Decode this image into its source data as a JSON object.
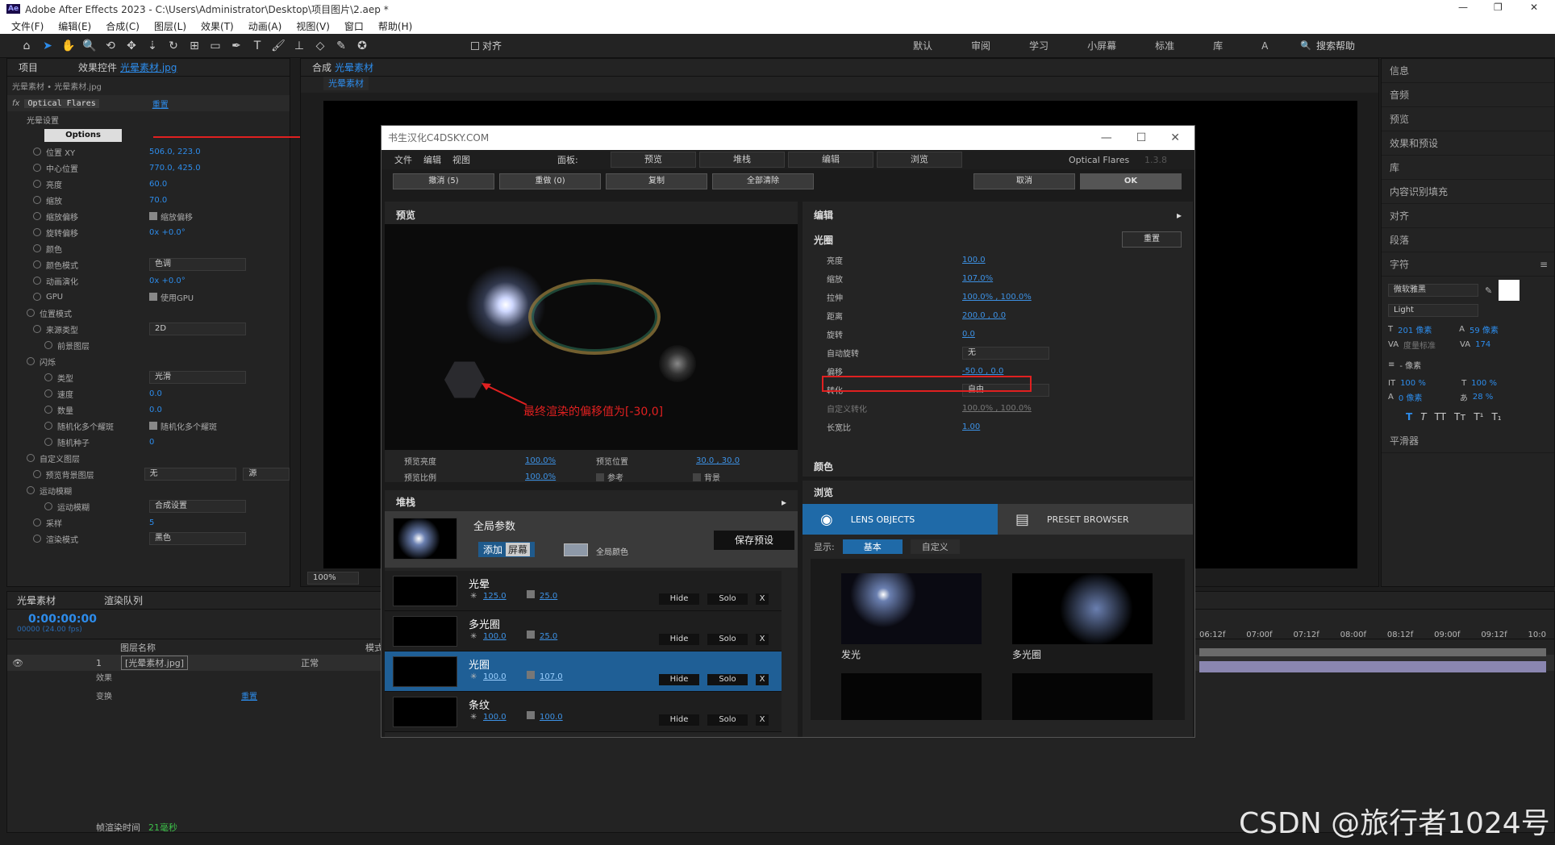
{
  "app": {
    "title": "Adobe After Effects 2023 - C:\\Users\\Administrator\\Desktop\\项目图片\\2.aep *",
    "logo": "Ae"
  },
  "menu": [
    "文件(F)",
    "编辑(E)",
    "合成(C)",
    "图层(L)",
    "效果(T)",
    "动画(A)",
    "视图(V)",
    "窗口",
    "帮助(H)"
  ],
  "toolbar": {
    "snap_label": "对齐",
    "workspaces": [
      "默认",
      "审阅",
      "学习",
      "小屏幕",
      "标准",
      "库",
      "A"
    ],
    "search_placeholder": "搜索帮助"
  },
  "left_panel": {
    "tab_project": "项目",
    "tab_effects": "效果控件",
    "tab_effects_file": "光晕素材.jpg",
    "breadcrumb": "光晕素材 • 光晕素材.jpg",
    "effect_name": "Optical Flares",
    "reset": "重置",
    "group_flare": "光晕设置",
    "options_btn": "Options",
    "props": [
      {
        "label": "位置 XY",
        "value": "506.0, 223.0"
      },
      {
        "label": "中心位置",
        "value": "770.0, 425.0"
      },
      {
        "label": "亮度",
        "value": "60.0"
      },
      {
        "label": "缩放",
        "value": "70.0"
      },
      {
        "label": "缩放偏移",
        "value": "缩放偏移"
      },
      {
        "label": "旋转偏移",
        "value": "0x +0.0°"
      },
      {
        "label": "颜色",
        "value": ""
      },
      {
        "label": "颜色模式",
        "value": "色调"
      },
      {
        "label": "动画演化",
        "value": "0x +0.0°"
      },
      {
        "label": "GPU",
        "value": "使用GPU"
      },
      {
        "label": "位置模式",
        "value": ""
      },
      {
        "label": "来源类型",
        "value": "2D"
      },
      {
        "label": "前景图层",
        "value": ""
      },
      {
        "label": "闪烁",
        "value": ""
      },
      {
        "label": "类型",
        "value": "光滑"
      },
      {
        "label": "速度",
        "value": "0.0"
      },
      {
        "label": "数量",
        "value": "0.0"
      },
      {
        "label": "随机化多个耀斑",
        "value": "随机化多个耀斑"
      },
      {
        "label": "随机种子",
        "value": "0"
      },
      {
        "label": "自定义图层",
        "value": ""
      },
      {
        "label": "预览背景图层",
        "value": "无"
      },
      {
        "label": "运动模糊",
        "value": ""
      },
      {
        "label": "运动模糊",
        "value": "合成设置"
      },
      {
        "label": "采样",
        "value": "5"
      },
      {
        "label": "渲染模式",
        "value": "黑色"
      }
    ],
    "source_label": "源"
  },
  "comp_panel": {
    "tab": "合成",
    "comp_name": "光晕素材",
    "sub_tab": "光晕素材",
    "zoom": "100%"
  },
  "dialog": {
    "title": "书生汉化C4DSKY.COM",
    "menu": [
      "文件",
      "编辑",
      "视图"
    ],
    "panel_label": "面板:",
    "tabs": [
      "预览",
      "堆栈",
      "编辑",
      "浏览"
    ],
    "brand": "Optical Flares",
    "version": "1.3.8",
    "btn_undo": "撤消 (5)",
    "btn_redo": "重做 (0)",
    "btn_copy": "复制",
    "btn_clear": "全部清除",
    "btn_cancel": "取消",
    "btn_ok": "OK",
    "preview_title": "预览",
    "annotation": "最终渲染的偏移值为[-30,0]",
    "preview_brightness_label": "预览亮度",
    "preview_brightness": "100.0%",
    "preview_scale_label": "预览比例",
    "preview_scale": "100.0%",
    "preview_pos_label": "预览位置",
    "preview_pos": "30.0 , 30.0",
    "ref_label": "参考",
    "bg_label": "背景",
    "edit_title": "编辑",
    "edit_sub": "光圈",
    "edit_reset": "重置",
    "edit_rows": [
      {
        "label": "亮度",
        "value": "100.0"
      },
      {
        "label": "缩放",
        "value": "107.0%"
      },
      {
        "label": "拉伸",
        "value": "100.0% , 100.0%"
      },
      {
        "label": "距离",
        "value": "200.0 , 0.0"
      },
      {
        "label": "旋转",
        "value": "0.0"
      },
      {
        "label": "自动旋转",
        "value": "无"
      },
      {
        "label": "偏移",
        "value": "-50.0 , 0.0"
      },
      {
        "label": "转化",
        "value": "自由"
      },
      {
        "label": "自定义转化",
        "value": "100.0% , 100.0%"
      },
      {
        "label": "长宽比",
        "value": "1.00"
      }
    ],
    "color_title": "颜色",
    "stack_title": "堆栈",
    "global_label": "全局参数",
    "blend_add": "添加",
    "blend_screen": "屏幕",
    "global_color": "全局颜色",
    "save_preset": "保存预设",
    "stack_rows": [
      {
        "name": "光晕",
        "a": "125.0",
        "b": "25.0"
      },
      {
        "name": "多光圈",
        "a": "100.0",
        "b": "25.0"
      },
      {
        "name": "光圈",
        "a": "100.0",
        "b": "107.0"
      },
      {
        "name": "条纹",
        "a": "100.0",
        "b": "100.0"
      }
    ],
    "hide": "Hide",
    "solo": "Solo",
    "x": "X",
    "browse_title": "浏览",
    "lens_objects": "LENS OBJECTS",
    "preset_browser": "PRESET BROWSER",
    "show_label": "显示:",
    "show_basic": "基本",
    "show_custom": "自定义",
    "browse_items": [
      "发光",
      "多光圈",
      "",
      ""
    ]
  },
  "right_panel": {
    "items": [
      "信息",
      "音频",
      "预览",
      "效果和预设",
      "库",
      "内容识别填充",
      "对齐",
      "段落"
    ],
    "char_title": "字符",
    "font": "微软雅黑",
    "font_style": "Light",
    "size": "201 像素",
    "leading": "59 像素",
    "kern": "度量标准",
    "track": "174",
    "indent": "- 像素",
    "vscale": "100 %",
    "hscale": "100 %",
    "baseline": "0 像素",
    "tsume": "28 %",
    "smoother": "平滑器"
  },
  "timeline": {
    "tab": "光晕素材",
    "tab_render": "渲染队列",
    "timecode": "0:00:00:00",
    "fps": "00000 (24.00 fps)",
    "col_name": "图层名称",
    "col_mode": "模式",
    "layer_num": "1",
    "layer_name": "[光晕素材.jpg]",
    "layer_mode": "正常",
    "sub1": "效果",
    "sub2": "变换",
    "sub2_reset": "重置",
    "ticks": [
      "06:12f",
      "07:00f",
      "07:12f",
      "08:00f",
      "08:12f",
      "09:00f",
      "09:12f",
      "10:0"
    ],
    "render_time_label": "帧渲染时间",
    "render_time": "21毫秒"
  },
  "watermark": "CSDN @旅行者1024号"
}
